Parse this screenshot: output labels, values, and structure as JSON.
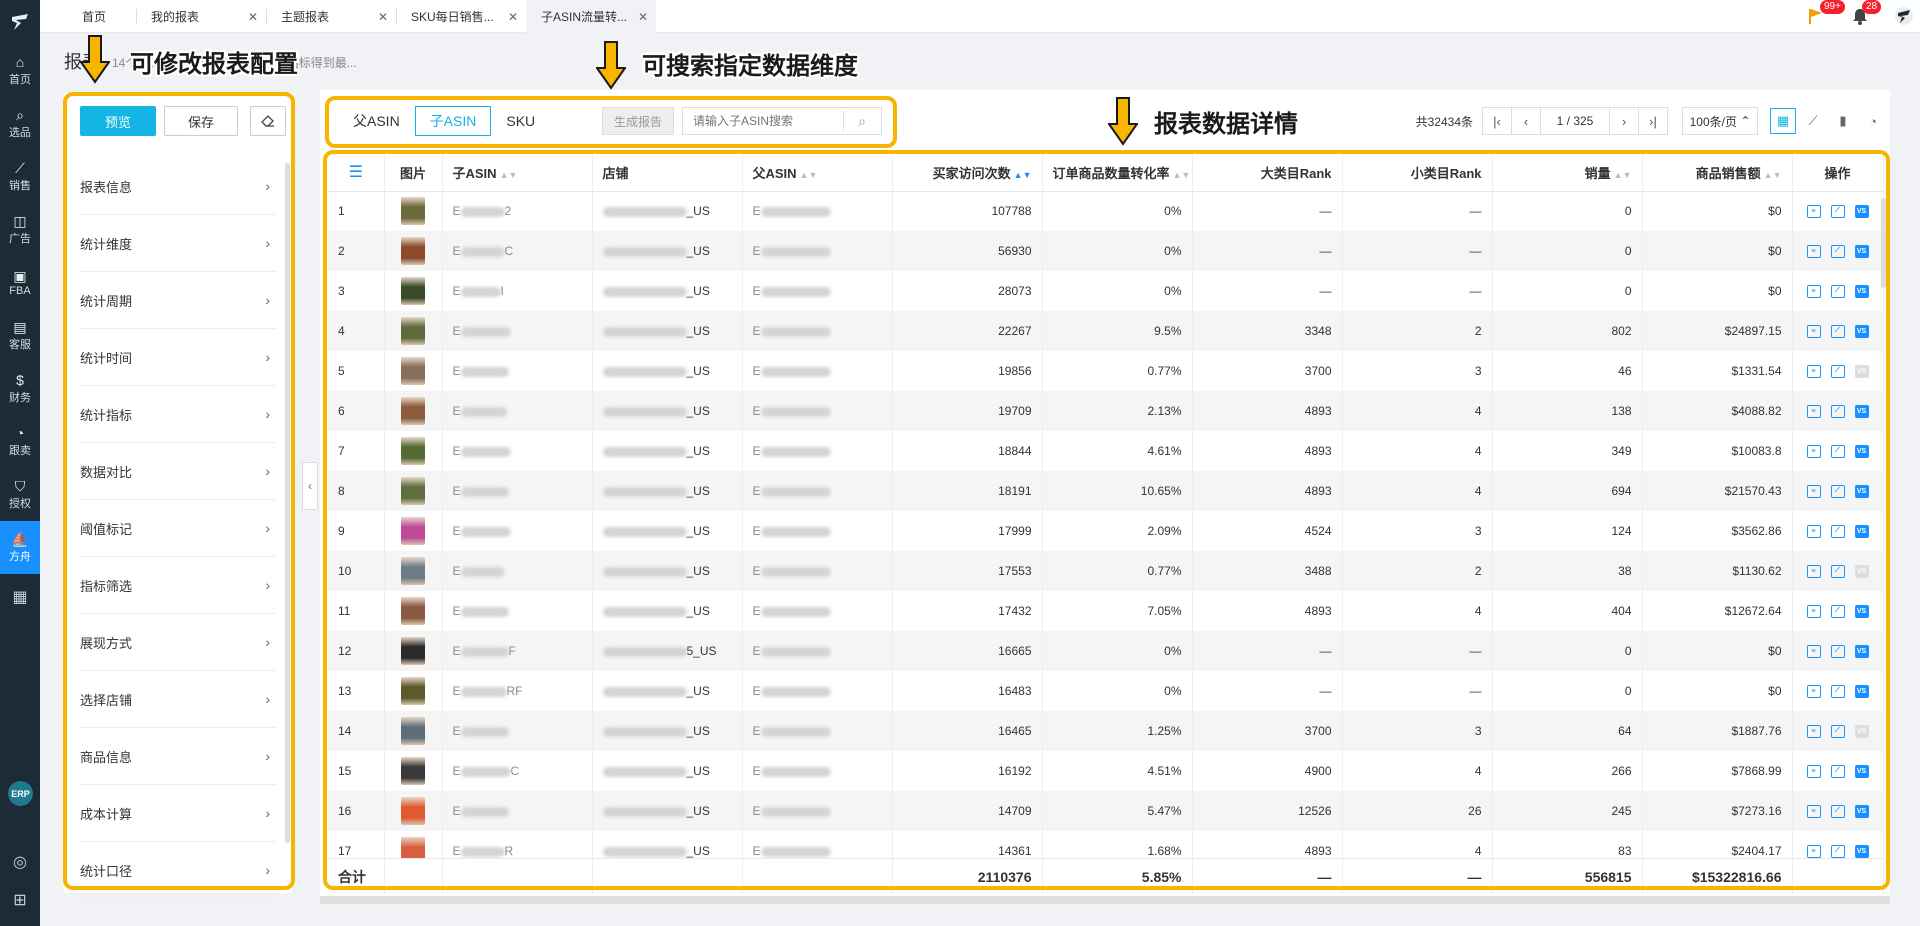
{
  "rail": {
    "items": [
      {
        "icon": "⌂",
        "label": "首页"
      },
      {
        "icon": "⌕",
        "label": "选品"
      },
      {
        "icon": "⟋",
        "label": "销售"
      },
      {
        "icon": "◫",
        "label": "广告"
      },
      {
        "icon": "▣",
        "label": "FBA"
      },
      {
        "icon": "▤",
        "label": "客服"
      },
      {
        "icon": "$",
        "label": "财务"
      },
      {
        "icon": "◔",
        "label": "跟卖"
      },
      {
        "icon": "⛉",
        "label": "授权"
      },
      {
        "icon": "⛵",
        "label": "方舟"
      }
    ],
    "erp": "ERP"
  },
  "tabs": [
    {
      "label": "首页",
      "closable": false
    },
    {
      "label": "我的报表",
      "closable": true
    },
    {
      "label": "主题报表",
      "closable": true
    },
    {
      "label": "SKU每日销售...",
      "closable": true
    },
    {
      "label": "子ASIN流量转...",
      "closable": true
    }
  ],
  "topbar": {
    "flag_badge": "99+",
    "bell_badge": "28"
  },
  "header": {
    "title": "报表",
    "subtitle": "14个统计维度*6个时间维度*76个指标得到最..."
  },
  "config": {
    "preview": "预览",
    "save": "保存",
    "items": [
      "报表信息",
      "统计维度",
      "统计周期",
      "统计时间",
      "统计指标",
      "数据对比",
      "阈值标记",
      "指标筛选",
      "展现方式",
      "选择店铺",
      "商品信息",
      "成本计算",
      "统计口径"
    ]
  },
  "toolbar": {
    "segments": [
      "父ASIN",
      "子ASIN",
      "SKU"
    ],
    "active_segment": 1,
    "generate": "生成报告",
    "search_placeholder": "请输入子ASIN搜索"
  },
  "pager": {
    "total": "共32434条",
    "current": "1",
    "pages": "/ 325",
    "page_size": "100条/页"
  },
  "table": {
    "columns": [
      "图片",
      "子ASIN",
      "店铺",
      "父ASIN",
      "买家访问次数",
      "订单商品数量转化率",
      "大类目Rank",
      "小类目Rank",
      "销量",
      "商品销售额",
      "操作"
    ],
    "rows": [
      {
        "no": "1",
        "asin_tail": "2",
        "shop_tail": "_US",
        "visits": "107788",
        "cvr": "0%",
        "rank_big": "—",
        "rank_small": "—",
        "qty": "0",
        "sales": "$0",
        "color": "#6b6a3c",
        "vs": true
      },
      {
        "no": "2",
        "asin_tail": "C",
        "shop_tail": "_US",
        "visits": "56930",
        "cvr": "0%",
        "rank_big": "—",
        "rank_small": "—",
        "qty": "0",
        "sales": "$0",
        "color": "#8a4a2b",
        "vs": true
      },
      {
        "no": "3",
        "asin_tail": "I",
        "shop_tail": "_US",
        "visits": "28073",
        "cvr": "0%",
        "rank_big": "—",
        "rank_small": "—",
        "qty": "0",
        "sales": "$0",
        "color": "#3a4a2a",
        "vs": true
      },
      {
        "no": "4",
        "asin_tail": "",
        "shop_tail": "_US",
        "visits": "22267",
        "cvr": "9.5%",
        "rank_big": "3348",
        "rank_small": "2",
        "qty": "802",
        "sales": "$24897.15",
        "color": "#5d6a3a",
        "vs": true
      },
      {
        "no": "5",
        "asin_tail": "",
        "shop_tail": "_US",
        "visits": "19856",
        "cvr": "0.77%",
        "rank_big": "3700",
        "rank_small": "3",
        "qty": "46",
        "sales": "$1331.54",
        "color": "#8a6d5a",
        "vs": false
      },
      {
        "no": "6",
        "asin_tail": "",
        "shop_tail": "_US",
        "visits": "19709",
        "cvr": "2.13%",
        "rank_big": "4893",
        "rank_small": "4",
        "qty": "138",
        "sales": "$4088.82",
        "color": "#8c5a3c",
        "vs": true
      },
      {
        "no": "7",
        "asin_tail": "",
        "shop_tail": "_US",
        "visits": "18844",
        "cvr": "4.61%",
        "rank_big": "4893",
        "rank_small": "4",
        "qty": "349",
        "sales": "$10083.8",
        "color": "#556b35",
        "vs": true
      },
      {
        "no": "8",
        "asin_tail": "",
        "shop_tail": "_US",
        "visits": "18191",
        "cvr": "10.65%",
        "rank_big": "4893",
        "rank_small": "4",
        "qty": "694",
        "sales": "$21570.43",
        "color": "#5f6e3c",
        "vs": true
      },
      {
        "no": "9",
        "asin_tail": "",
        "shop_tail": "_US",
        "visits": "17999",
        "cvr": "2.09%",
        "rank_big": "4524",
        "rank_small": "3",
        "qty": "124",
        "sales": "$3562.86",
        "color": "#c04a9a",
        "vs": true
      },
      {
        "no": "10",
        "asin_tail": "",
        "shop_tail": "_US",
        "visits": "17553",
        "cvr": "0.77%",
        "rank_big": "3488",
        "rank_small": "2",
        "qty": "38",
        "sales": "$1130.62",
        "color": "#6d7d85",
        "vs": false
      },
      {
        "no": "11",
        "asin_tail": "",
        "shop_tail": "_US",
        "visits": "17432",
        "cvr": "7.05%",
        "rank_big": "4893",
        "rank_small": "4",
        "qty": "404",
        "sales": "$12672.64",
        "color": "#8a5a40",
        "vs": true
      },
      {
        "no": "12",
        "asin_tail": "F",
        "shop_tail": "5_US",
        "visits": "16665",
        "cvr": "0%",
        "rank_big": "—",
        "rank_small": "—",
        "qty": "0",
        "sales": "$0",
        "color": "#2a2a2a",
        "vs": true
      },
      {
        "no": "13",
        "asin_tail": "RF",
        "shop_tail": "_US",
        "visits": "16483",
        "cvr": "0%",
        "rank_big": "—",
        "rank_small": "—",
        "qty": "0",
        "sales": "$0",
        "color": "#5a5a2a",
        "vs": true
      },
      {
        "no": "14",
        "asin_tail": "",
        "shop_tail": "_US",
        "visits": "16465",
        "cvr": "1.25%",
        "rank_big": "3700",
        "rank_small": "3",
        "qty": "64",
        "sales": "$1887.76",
        "color": "#5d6e78",
        "vs": false
      },
      {
        "no": "15",
        "asin_tail": "C",
        "shop_tail": "_US",
        "visits": "16192",
        "cvr": "4.51%",
        "rank_big": "4900",
        "rank_small": "4",
        "qty": "266",
        "sales": "$7868.99",
        "color": "#3a3a3a",
        "vs": true
      },
      {
        "no": "16",
        "asin_tail": "",
        "shop_tail": "_US",
        "visits": "14709",
        "cvr": "5.47%",
        "rank_big": "12526",
        "rank_small": "26",
        "qty": "245",
        "sales": "$7273.16",
        "color": "#e05a30",
        "vs": true
      },
      {
        "no": "17",
        "asin_tail": "R",
        "shop_tail": "_US",
        "visits": "14361",
        "cvr": "1.68%",
        "rank_big": "4893",
        "rank_small": "4",
        "qty": "83",
        "sales": "$2404.17",
        "color": "#d86040",
        "vs": true
      }
    ],
    "totals": {
      "label": "合计",
      "visits": "2110376",
      "cvr": "5.85%",
      "rank_big": "—",
      "rank_small": "—",
      "qty": "556815",
      "sales": "$15322816.66"
    }
  },
  "annotations": {
    "config": "可修改报表配置",
    "search": "可搜索指定数据维度",
    "table": "报表数据详情"
  },
  "colors": {
    "accent": "#13b5e4",
    "highlight": "#f7b500",
    "rail": "#1c2b36",
    "active_rail": "#1890ff"
  }
}
